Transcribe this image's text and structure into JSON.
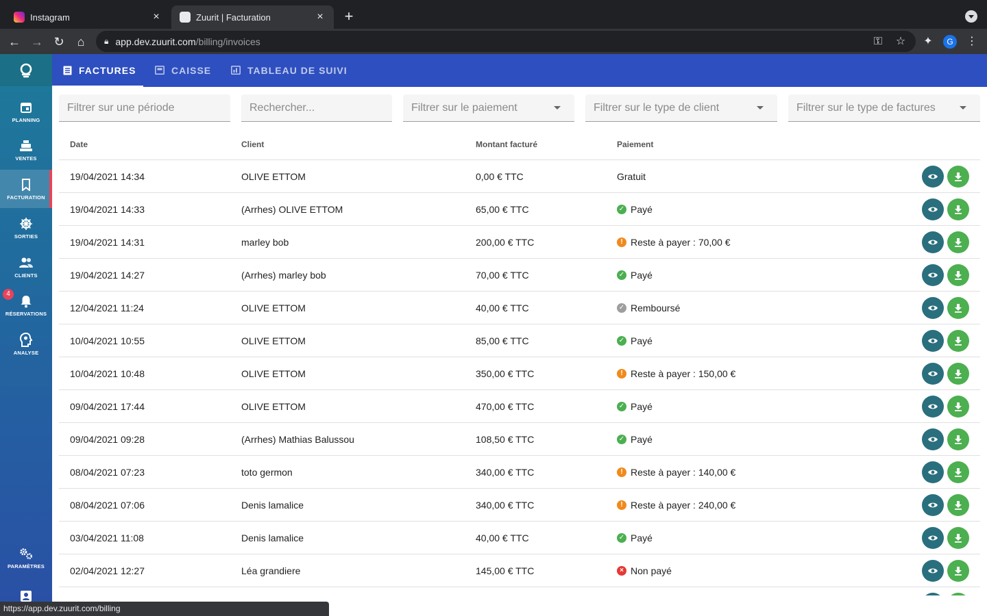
{
  "browser": {
    "tabs": [
      {
        "title": "Instagram",
        "close": "×"
      },
      {
        "title": "Zuurit | Facturation",
        "close": "×"
      }
    ],
    "new_tab": "+",
    "url_host": "app.dev.zuurit.com",
    "url_path": "/billing/invoices",
    "profile_initial": "G",
    "status_url": "https://app.dev.zuurit.com/billing"
  },
  "sidebar": {
    "items": [
      {
        "label": "PLANNING",
        "icon": "calendar-icon"
      },
      {
        "label": "VENTES",
        "icon": "cash-register-icon"
      },
      {
        "label": "FACTURATION",
        "icon": "bookmark-icon",
        "active": true
      },
      {
        "label": "SORTIES",
        "icon": "ship-wheel-icon"
      },
      {
        "label": "CLIENTS",
        "icon": "users-icon"
      },
      {
        "label": "RÉSERVATIONS",
        "icon": "bell-icon",
        "badge": "4"
      },
      {
        "label": "ANALYSE",
        "icon": "lightbulb-head-icon"
      },
      {
        "label": "PARAMÈTRES",
        "icon": "gears-icon"
      }
    ]
  },
  "appnav": {
    "tabs": [
      {
        "label": "FACTURES",
        "active": true
      },
      {
        "label": "CAISSE"
      },
      {
        "label": "TABLEAU DE SUIVI"
      }
    ]
  },
  "filters": {
    "period": "Filtrer sur une période",
    "search": "Rechercher...",
    "payment": "Filtrer sur le paiement",
    "client_type": "Filtrer sur le type de client",
    "invoice_type": "Filtrer sur le type de factures"
  },
  "table": {
    "headers": {
      "date": "Date",
      "client": "Client",
      "amount": "Montant facturé",
      "payment": "Paiement"
    },
    "rows": [
      {
        "date": "19/04/2021 14:34",
        "client": "OLIVE ETTOM",
        "amount": "0,00 € TTC",
        "payment": "Gratuit",
        "status": "none"
      },
      {
        "date": "19/04/2021 14:33",
        "client": "(Arrhes) OLIVE ETTOM",
        "amount": "65,00 € TTC",
        "payment": "Payé",
        "status": "paid"
      },
      {
        "date": "19/04/2021 14:31",
        "client": "marley bob",
        "amount": "200,00 € TTC",
        "payment": "Reste à payer : 70,00 €",
        "status": "due"
      },
      {
        "date": "19/04/2021 14:27",
        "client": "(Arrhes) marley bob",
        "amount": "70,00 € TTC",
        "payment": "Payé",
        "status": "paid"
      },
      {
        "date": "12/04/2021 11:24",
        "client": "OLIVE ETTOM",
        "amount": "40,00 € TTC",
        "payment": "Remboursé",
        "status": "refund"
      },
      {
        "date": "10/04/2021 10:55",
        "client": "OLIVE ETTOM",
        "amount": "85,00 € TTC",
        "payment": "Payé",
        "status": "paid"
      },
      {
        "date": "10/04/2021 10:48",
        "client": "OLIVE ETTOM",
        "amount": "350,00 € TTC",
        "payment": "Reste à payer : 150,00 €",
        "status": "due"
      },
      {
        "date": "09/04/2021 17:44",
        "client": "OLIVE ETTOM",
        "amount": "470,00 € TTC",
        "payment": "Payé",
        "status": "paid"
      },
      {
        "date": "09/04/2021 09:28",
        "client": "(Arrhes) Mathias Balussou",
        "amount": "108,50 € TTC",
        "payment": "Payé",
        "status": "paid"
      },
      {
        "date": "08/04/2021 07:23",
        "client": "toto germon",
        "amount": "340,00 € TTC",
        "payment": "Reste à payer : 140,00 €",
        "status": "due"
      },
      {
        "date": "08/04/2021 07:06",
        "client": "Denis lamalice",
        "amount": "340,00 € TTC",
        "payment": "Reste à payer : 240,00 €",
        "status": "due"
      },
      {
        "date": "03/04/2021 11:08",
        "client": "Denis lamalice",
        "amount": "40,00 € TTC",
        "payment": "Payé",
        "status": "paid"
      },
      {
        "date": "02/04/2021 12:27",
        "client": "Léa grandiere",
        "amount": "145,00 € TTC",
        "payment": "Non payé",
        "status": "unpaid"
      }
    ]
  },
  "colors": {
    "appbar": "#2e4fbf",
    "sidebar_top": "#1e7a9a",
    "sidebar_bottom": "#2a4fa6",
    "active_marker": "#e8435a",
    "view_button": "#2a6f7d",
    "download_button": "#4caf50"
  }
}
